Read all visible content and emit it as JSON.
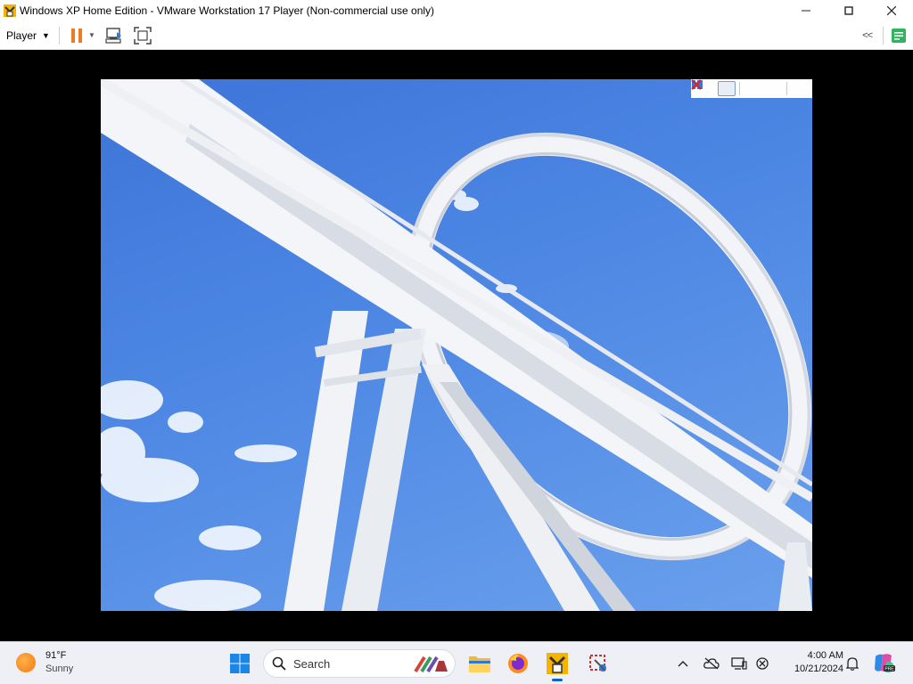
{
  "window": {
    "title": "Windows XP Home Edition - VMware Workstation 17 Player (Non-commercial use only)",
    "minimize": "–",
    "maximize": "☐",
    "close": "✕"
  },
  "toolbar": {
    "player_label": "Player",
    "player_caret": "▼",
    "pause_caret": "▼",
    "collapse": "<<"
  },
  "slideshow": {
    "controls": [
      "play-icon",
      "pause-icon",
      "previous-icon",
      "next-icon",
      "close-icon"
    ],
    "active_control": "pause",
    "image": "white roller coaster loop against blue sky"
  },
  "taskbar": {
    "weather": {
      "temp": "91°F",
      "condition": "Sunny"
    },
    "search_placeholder": "Search",
    "pinned": [
      "start-icon",
      "file-explorer-icon",
      "firefox-icon",
      "vmware-icon",
      "snipping-tool-icon"
    ],
    "tray": [
      "chevron-up-icon",
      "onedrive-icon",
      "display-icon",
      "network-icon",
      "notification-icon",
      "copilot-icon"
    ],
    "time": "4:00 AM",
    "date": "10/21/2024",
    "accent": "#0a64c8"
  }
}
